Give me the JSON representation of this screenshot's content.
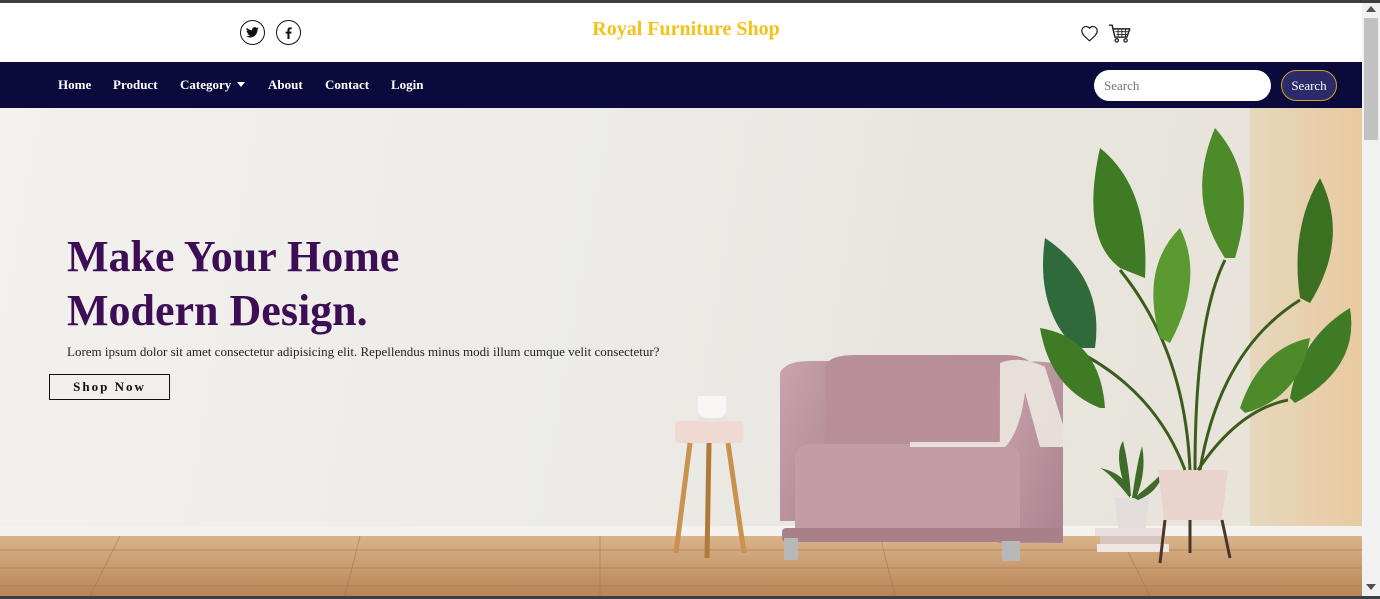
{
  "header": {
    "brand": "Royal Furniture Shop",
    "social": [
      {
        "name": "twitter-icon"
      },
      {
        "name": "facebook-icon"
      }
    ],
    "icons": [
      "heart-icon",
      "cart-icon"
    ]
  },
  "nav": {
    "items": [
      {
        "label": "Home"
      },
      {
        "label": "Product"
      },
      {
        "label": "Category"
      },
      {
        "label": "About"
      },
      {
        "label": "Contact"
      },
      {
        "label": "Login"
      }
    ],
    "search_placeholder": "Search",
    "search_button": "Search"
  },
  "hero": {
    "title_line1": "Make Your Home",
    "title_line2": "Modern Design.",
    "subtitle": "Lorem ipsum dolor sit amet consectetur adipisicing elit. Repellendus minus modi illum cumque velit consectetur?",
    "button": "Shop Now"
  },
  "colors": {
    "brand": "#f5c117",
    "navbar": "#0b0a3c",
    "hero_title": "#3d0d55"
  }
}
